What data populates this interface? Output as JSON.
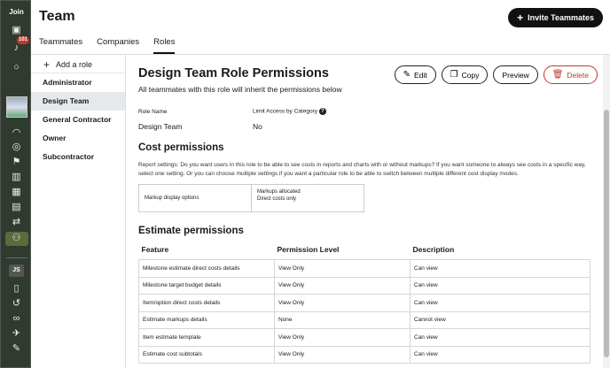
{
  "rail": {
    "join_label": "Join",
    "badge": "101",
    "user_initials": "JS"
  },
  "header": {
    "title": "Team",
    "invite_label": "Invite Teammates",
    "tabs": [
      {
        "label": "Teammates"
      },
      {
        "label": "Companies"
      },
      {
        "label": "Roles"
      }
    ]
  },
  "roles": {
    "add_label": "Add a role",
    "items": [
      {
        "label": "Administrator"
      },
      {
        "label": "Design Team"
      },
      {
        "label": "General Contractor"
      },
      {
        "label": "Owner"
      },
      {
        "label": "Subcontractor"
      }
    ],
    "selected": "Design Team"
  },
  "main": {
    "title": "Design Team Role Permissions",
    "subtitle": "All teammates with this role will inherit the permissions below",
    "actions": {
      "edit": "Edit",
      "copy": "Copy",
      "preview": "Preview",
      "delete": "Delete"
    },
    "role_name_label": "Role Name",
    "role_name_value": "Design Team",
    "limit_access_label": "Limit Access by Category",
    "limit_access_value": "No",
    "cost": {
      "heading": "Cost permissions",
      "description": "Report settings: Do you want users in this role to be able to see costs in reports and charts with or without markups? If you want someone to always see costs in a specific way, select one setting. Or you can choose multiple settings if you want a particular role to be able to switch between multiple different cost display modes.",
      "markup_label": "Markup display options",
      "markup_line1": "Markups allocated",
      "markup_line2": "Direct costs only"
    },
    "estimate": {
      "heading": "Estimate permissions",
      "columns": [
        "Feature",
        "Permission Level",
        "Description"
      ],
      "rows": [
        {
          "feature": "Milestone estimate direct costs details",
          "level": "View Only",
          "desc": "Can view"
        },
        {
          "feature": "Milestone target budget details",
          "level": "View Only",
          "desc": "Can view"
        },
        {
          "feature": "Item/option direct costs details",
          "level": "View Only",
          "desc": "Can view"
        },
        {
          "feature": "Estimate markups details",
          "level": "None",
          "desc": "Cannot view"
        },
        {
          "feature": "Item estimate template",
          "level": "View Only",
          "desc": "Can view"
        },
        {
          "feature": "Estimate cost subtotals",
          "level": "View Only",
          "desc": "Can view"
        }
      ]
    }
  }
}
